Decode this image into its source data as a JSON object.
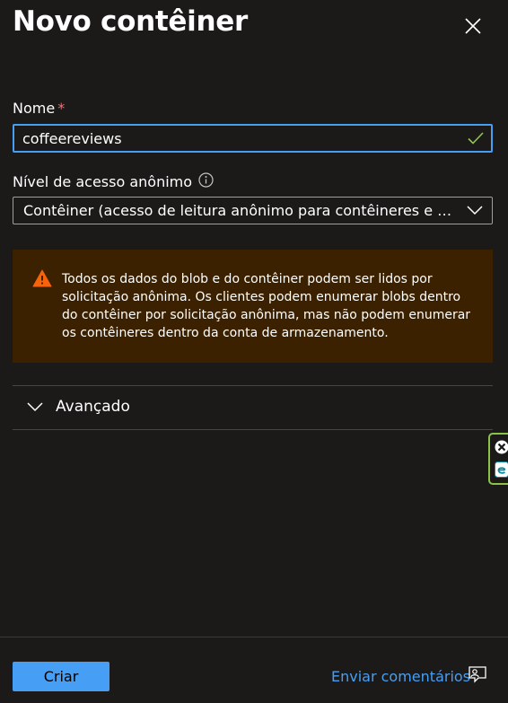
{
  "panel": {
    "title": "Novo contêiner"
  },
  "name_field": {
    "label": "Nome",
    "required_mark": "*",
    "value": "coffeereviews"
  },
  "access_level": {
    "label": "Nível de acesso anônimo",
    "selected": "Contêiner (acesso de leitura anônimo para contêineres e blo..."
  },
  "warning": {
    "text": "Todos os dados do blob e do contêiner podem ser lidos por solicitação anônima. Os clientes podem enumerar blobs dentro do contêiner por solicitação anônima, mas não podem enumerar os contêineres dentro da conta de armazenamento."
  },
  "advanced": {
    "label": "Avançado"
  },
  "footer": {
    "create_label": "Criar",
    "feedback_label": "Enviar comentários"
  },
  "icons": {
    "close": "close-icon",
    "check": "check-icon",
    "info": "info-icon",
    "select_chevron": "chevron-down-icon",
    "warning": "warning-icon",
    "advanced_chevron": "chevron-down-icon",
    "feedback": "feedback-icon"
  },
  "colors": {
    "background": "#1b1a19",
    "accent": "#479ef5",
    "warning_bg": "#3b2100",
    "warning_icon": "#f7630c",
    "required": "#f1707b",
    "valid_check": "#92c353"
  }
}
